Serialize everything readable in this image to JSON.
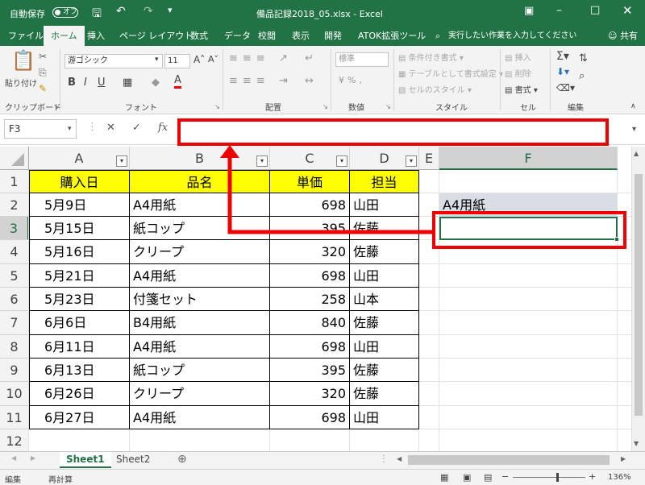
{
  "titlebar": {
    "autosave_label": "自動保存",
    "autosave_state": "オフ",
    "filename": "備品記録2018_05.xlsx - Excel"
  },
  "menu": {
    "tabs": [
      "ファイル",
      "ホーム",
      "挿入",
      "ページ レイアウト",
      "数式",
      "データ",
      "校閲",
      "表示",
      "開発",
      "ATOK拡張ツール"
    ],
    "search": "実行したい作業を入力してください",
    "share": "共有"
  },
  "ribbon": {
    "clipboard": {
      "paste": "貼り付け",
      "group": "クリップボード"
    },
    "font": {
      "name": "游ゴシック",
      "size": "11",
      "group": "フォント",
      "bold": "B",
      "italic": "I",
      "underline": "U"
    },
    "align": {
      "group": "配置"
    },
    "number": {
      "format": "標準",
      "group": "数値"
    },
    "styles": {
      "cond": "条件付き書式",
      "table": "テーブルとして書式設定",
      "cell": "セルのスタイル",
      "group": "スタイル"
    },
    "cells": {
      "insert": "挿入",
      "delete": "削除",
      "format": "書式",
      "group": "セル"
    },
    "edit": {
      "group": "編集"
    }
  },
  "formula": {
    "namebox": "F3",
    "value": ""
  },
  "columns": [
    "A",
    "B",
    "C",
    "D",
    "E",
    "F"
  ],
  "rows": [
    "1",
    "2",
    "3",
    "4",
    "5",
    "6",
    "7",
    "8",
    "9",
    "10",
    "11",
    "12"
  ],
  "table": {
    "headers": [
      "購入日",
      "品名",
      "単価",
      "担当"
    ],
    "data": [
      [
        "5月9日",
        "A4用紙",
        "698",
        "山田"
      ],
      [
        "5月15日",
        "紙コップ",
        "395",
        "佐藤"
      ],
      [
        "5月16日",
        "クリープ",
        "320",
        "佐藤"
      ],
      [
        "5月21日",
        "A4用紙",
        "698",
        "山田"
      ],
      [
        "5月23日",
        "付箋セット",
        "258",
        "山本"
      ],
      [
        "6月6日",
        "B4用紙",
        "840",
        "佐藤"
      ],
      [
        "6月11日",
        "A4用紙",
        "698",
        "山田"
      ],
      [
        "6月13日",
        "紙コップ",
        "395",
        "佐藤"
      ],
      [
        "6月26日",
        "クリープ",
        "320",
        "佐藤"
      ],
      [
        "6月27日",
        "A4用紙",
        "698",
        "山田"
      ]
    ]
  },
  "f2": "A4用紙",
  "sheets": [
    "Sheet1",
    "Sheet2"
  ],
  "status": {
    "mode": "編集",
    "calc": "再計算",
    "zoom": "136%"
  },
  "colors": {
    "excel_green": "#217346",
    "header_fill": "#ffff00",
    "highlight": "#e00000"
  }
}
